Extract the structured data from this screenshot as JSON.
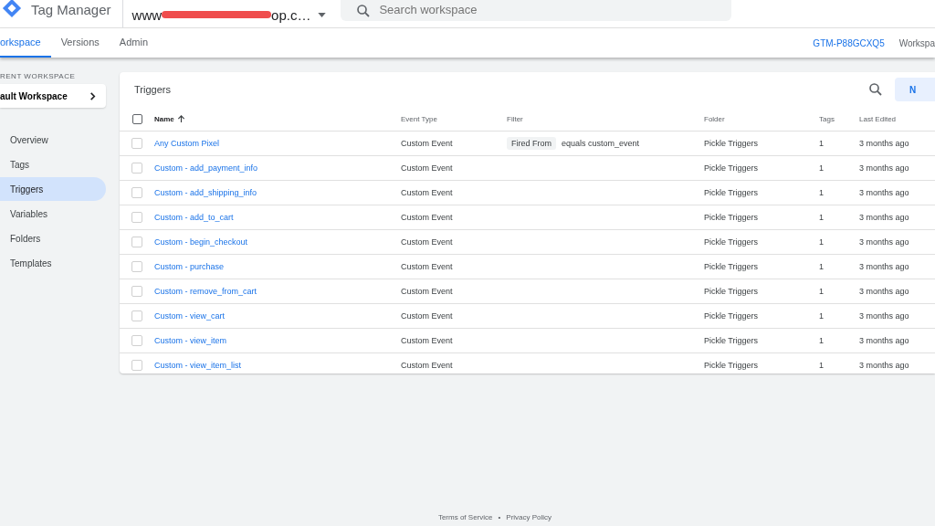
{
  "header": {
    "product": "Tag Manager",
    "account": {
      "prefix": "www",
      "suffix": "op.c…"
    },
    "search": {
      "placeholder": "Search workspace"
    }
  },
  "tabs": [
    {
      "label": "orkspace",
      "selected": true
    },
    {
      "label": "Versions",
      "selected": false
    },
    {
      "label": "Admin",
      "selected": false
    }
  ],
  "container_id": "GTM-P88GCXQ5",
  "workspace_link": "Workspa",
  "sidebar": {
    "heading": "RENT WORKSPACE",
    "workspace": "ault Workspace",
    "items": [
      {
        "label": "Overview",
        "selected": false
      },
      {
        "label": "Tags",
        "selected": false
      },
      {
        "label": "Triggers",
        "selected": true
      },
      {
        "label": "Variables",
        "selected": false
      },
      {
        "label": "Folders",
        "selected": false
      },
      {
        "label": "Templates",
        "selected": false
      }
    ]
  },
  "card": {
    "title": "Triggers",
    "new_button": "N"
  },
  "table": {
    "all_checked": false,
    "columns": [
      "Name",
      "Event Type",
      "Filter",
      "Folder",
      "Tags",
      "Last Edited"
    ],
    "rows": [
      {
        "name": "Any Custom Pixel",
        "event_type": "Custom Event",
        "filter": {
          "variable": "Fired From",
          "condition": "equals custom_event"
        },
        "folder": "Pickle Triggers",
        "tags": "1",
        "last_edited": "3 months ago",
        "checked": false
      },
      {
        "name": "Custom - add_payment_info",
        "event_type": "Custom Event",
        "folder": "Pickle Triggers",
        "tags": "1",
        "last_edited": "3 months ago",
        "checked": false
      },
      {
        "name": "Custom - add_shipping_info",
        "event_type": "Custom Event",
        "folder": "Pickle Triggers",
        "tags": "1",
        "last_edited": "3 months ago",
        "checked": false
      },
      {
        "name": "Custom - add_to_cart",
        "event_type": "Custom Event",
        "folder": "Pickle Triggers",
        "tags": "1",
        "last_edited": "3 months ago",
        "checked": false
      },
      {
        "name": "Custom - begin_checkout",
        "event_type": "Custom Event",
        "folder": "Pickle Triggers",
        "tags": "1",
        "last_edited": "3 months ago",
        "checked": false
      },
      {
        "name": "Custom - purchase",
        "event_type": "Custom Event",
        "folder": "Pickle Triggers",
        "tags": "1",
        "last_edited": "3 months ago",
        "checked": false
      },
      {
        "name": "Custom - remove_from_cart",
        "event_type": "Custom Event",
        "folder": "Pickle Triggers",
        "tags": "1",
        "last_edited": "3 months ago",
        "checked": false
      },
      {
        "name": "Custom - view_cart",
        "event_type": "Custom Event",
        "folder": "Pickle Triggers",
        "tags": "1",
        "last_edited": "3 months ago",
        "checked": false
      },
      {
        "name": "Custom - view_item",
        "event_type": "Custom Event",
        "folder": "Pickle Triggers",
        "tags": "1",
        "last_edited": "3 months ago",
        "checked": false
      },
      {
        "name": "Custom - view_item_list",
        "event_type": "Custom Event",
        "folder": "Pickle Triggers",
        "tags": "1",
        "last_edited": "3 months ago",
        "checked": false
      }
    ]
  },
  "footer": {
    "links": [
      "Terms of Service",
      "Privacy Policy"
    ],
    "separator": "•"
  }
}
